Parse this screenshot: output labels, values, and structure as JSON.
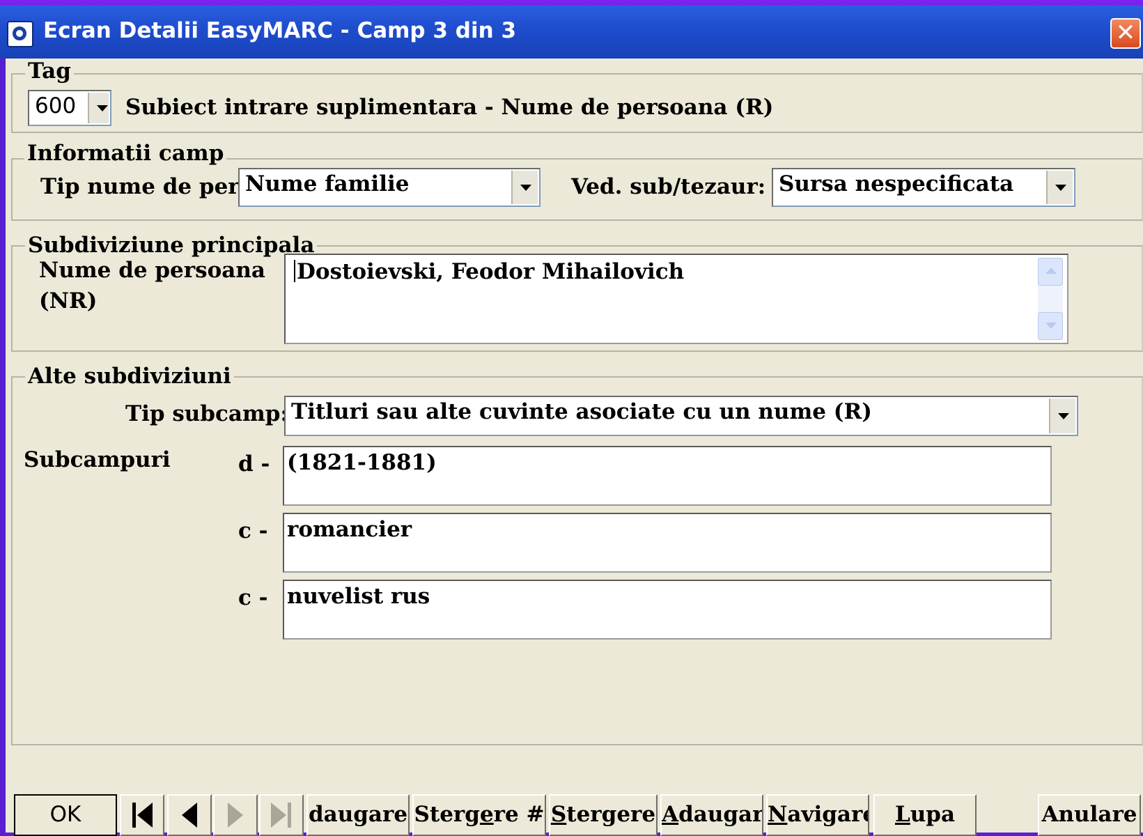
{
  "window": {
    "title": "Ecran Detalii EasyMARC - Camp 3 din 3",
    "app_icon": "easymarc-logo-icon",
    "close_glyph": "✕"
  },
  "tag": {
    "legend": "Tag",
    "value": "600",
    "description": "Subiect intrare suplimentara - Nume de persoana (R)"
  },
  "field_info": {
    "legend": "Informatii camp",
    "name_type_label": "Tip nume de per",
    "name_type_value": "Nume familie",
    "thesaurus_label": "Ved. sub/tezaur:",
    "thesaurus_value": "Sursa nespecificata"
  },
  "main_subdivision": {
    "legend": "Subdiviziune principala",
    "label_line1": "Nume de persoana",
    "label_line2": "(NR)",
    "value": "Dostoievski, Feodor Mihailovich"
  },
  "other_subdivisions": {
    "legend": "Alte subdiviziuni",
    "subfield_type_label": "Tip subcamp:",
    "subfield_type_value": "Titluri sau alte cuvinte asociate cu un nume (R)",
    "subfields_label": "Subcampuri",
    "subfields": [
      {
        "code": "d  -",
        "value": "(1821-1881)"
      },
      {
        "code": "c  -",
        "value": "romancier"
      },
      {
        "code": "c  -",
        "value": "nuvelist rus"
      }
    ]
  },
  "buttons": {
    "ok": "OK",
    "first_icon": "first-record-icon",
    "prev_icon": "previous-record-icon",
    "next_icon": "next-record-icon",
    "last_icon": "last-record-icon",
    "add": "daugare",
    "delete_hash_pre": "Sterg",
    "delete_hash_key": "e",
    "delete_hash_post": "re #",
    "delete_key": "S",
    "delete_rest": "tergere",
    "add2_key": "A",
    "add2_rest": "daugare",
    "navigate_key": "N",
    "navigate_rest": "avigare",
    "magnifier_key": "L",
    "magnifier_rest": "upa",
    "cancel": "Anulare"
  },
  "colors": {
    "titlebar": "#1e4ccc",
    "dialog_bg": "#ece9d8",
    "outer_bg": "#5a1fd0",
    "close_button": "#d9491f"
  }
}
